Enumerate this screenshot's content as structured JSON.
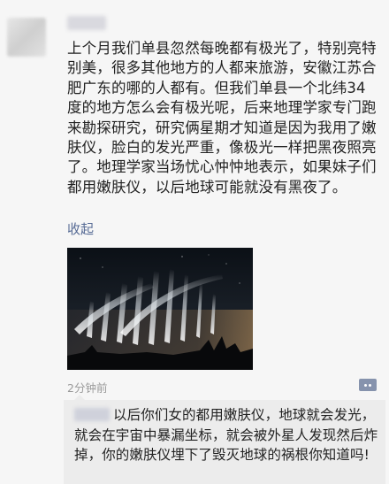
{
  "post": {
    "author_avatar": "blurred-avatar",
    "author_name_blurred": true,
    "text": "上个月我们单县忽然每晚都有极光了，特别亮特别美，很多其他地方的人都来旅游，安徽江苏合肥广东的哪的人都有。但我们单县一个北纬34度的地方怎么会有极光呢，后来地理学家专门跑来勘探研究，研究俩星期才知道是因为我用了嫩肤仪，脸白的发光严重，像极光一样把黑夜照亮了。地理学家当场忧心忡忡地表示，如果妹子们都用嫩肤仪，以后地球可能就没有黑夜了。",
    "collapse_label": "收起",
    "image": {
      "subject": "aurora-photo"
    },
    "timestamp": "2分钟前",
    "comment_icon": "comment-dots-icon"
  },
  "comments": [
    {
      "author_blurred": true,
      "text": "以后你们女的都用嫩肤仪，地球就会发光，就会在宇宙中暴漏坐标，就会被外星人发现然后炸掉，你的嫩肤仪埋下了毁灭地球的祸根你知道吗!"
    }
  ],
  "colors": {
    "link": "#576b95",
    "background": "#f6f6f6",
    "comment_panel": "#ececec",
    "text": "#222222",
    "muted": "#9a9a9a"
  }
}
